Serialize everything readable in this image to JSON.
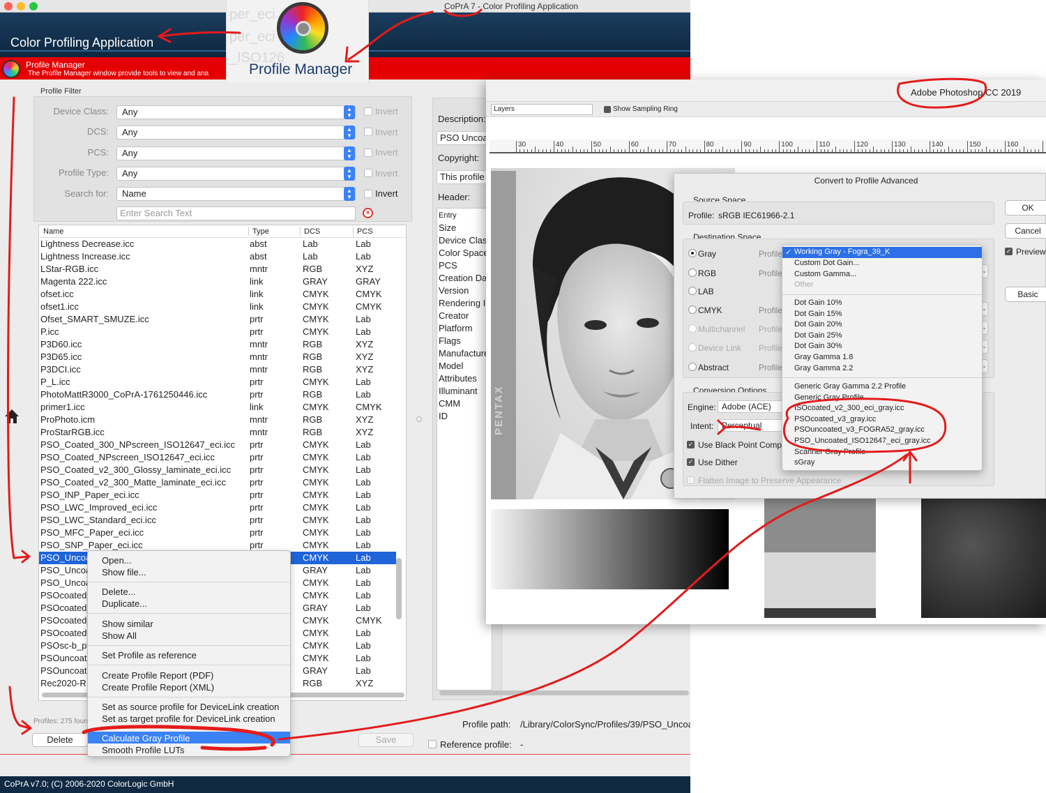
{
  "copra": {
    "window_title": "CoPrA 7 - Color Profiling Application",
    "app_title": "Color Profiling Application",
    "module_title": "Profile Manager",
    "module_desc": "The Profile Manager window provide tools to view and ana",
    "module_title_big": "Profile Manager",
    "ghost_texts": [
      "per_eci",
      "per_eci",
      "_ISO126",
      "_ISO12647_eci_gra",
      "d_NPscreen_ISO1261"
    ],
    "filter": {
      "section_label": "Profile Filter",
      "rows": [
        {
          "label": "Device Class:",
          "value": "Any",
          "invert": "Invert"
        },
        {
          "label": "DCS:",
          "value": "Any",
          "invert": "Invert"
        },
        {
          "label": "PCS:",
          "value": "Any",
          "invert": "Invert"
        },
        {
          "label": "Profile Type:",
          "value": "Any",
          "invert": "Invert"
        },
        {
          "label": "Search for:",
          "value": "Name",
          "invert": "Invert"
        }
      ],
      "search_placeholder": "Enter Search Text"
    },
    "table": {
      "headers": {
        "name": "Name",
        "type": "Type",
        "dcs": "DCS",
        "pcs": "PCS"
      },
      "rows": [
        [
          "Lightness Decrease.icc",
          "abst",
          "Lab",
          "Lab"
        ],
        [
          "Lightness Increase.icc",
          "abst",
          "Lab",
          "Lab"
        ],
        [
          "LStar-RGB.icc",
          "mntr",
          "RGB",
          "XYZ"
        ],
        [
          "Magenta 222.icc",
          "link",
          "GRAY",
          "GRAY"
        ],
        [
          "ofset.icc",
          "link",
          "CMYK",
          "CMYK"
        ],
        [
          "ofset1.icc",
          "link",
          "CMYK",
          "CMYK"
        ],
        [
          "Ofset_SMART_SMUZE.icc",
          "prtr",
          "CMYK",
          "Lab"
        ],
        [
          "P.icc",
          "prtr",
          "CMYK",
          "Lab"
        ],
        [
          "P3D60.icc",
          "mntr",
          "RGB",
          "XYZ"
        ],
        [
          "P3D65.icc",
          "mntr",
          "RGB",
          "XYZ"
        ],
        [
          "P3DCI.icc",
          "mntr",
          "RGB",
          "XYZ"
        ],
        [
          "P_L.icc",
          "prtr",
          "CMYK",
          "Lab"
        ],
        [
          "PhotoMattR3000_CoPrA-1761250446.icc",
          "prtr",
          "RGB",
          "Lab"
        ],
        [
          "primer1.icc",
          "link",
          "CMYK",
          "CMYK"
        ],
        [
          "ProPhoto.icm",
          "mntr",
          "RGB",
          "XYZ"
        ],
        [
          "ProStarRGB.icc",
          "mntr",
          "RGB",
          "XYZ"
        ],
        [
          "PSO_Coated_300_NPscreen_ISO12647_eci.icc",
          "prtr",
          "CMYK",
          "Lab"
        ],
        [
          "PSO_Coated_NPscreen_ISO12647_eci.icc",
          "prtr",
          "CMYK",
          "Lab"
        ],
        [
          "PSO_Coated_v2_300_Glossy_laminate_eci.icc",
          "prtr",
          "CMYK",
          "Lab"
        ],
        [
          "PSO_Coated_v2_300_Matte_laminate_eci.icc",
          "prtr",
          "CMYK",
          "Lab"
        ],
        [
          "PSO_INP_Paper_eci.icc",
          "prtr",
          "CMYK",
          "Lab"
        ],
        [
          "PSO_LWC_Improved_eci.icc",
          "prtr",
          "CMYK",
          "Lab"
        ],
        [
          "PSO_LWC_Standard_eci.icc",
          "prtr",
          "CMYK",
          "Lab"
        ],
        [
          "PSO_MFC_Paper_eci.icc",
          "prtr",
          "CMYK",
          "Lab"
        ],
        [
          "PSO_SNP_Paper_eci.icc",
          "prtr",
          "CMYK",
          "Lab"
        ],
        [
          "PSO_Uncoa",
          "",
          "CMYK",
          "Lab"
        ],
        [
          "PSO_Uncoa",
          "",
          "GRAY",
          "Lab"
        ],
        [
          "PSO_Uncoa",
          "",
          "CMYK",
          "Lab"
        ],
        [
          "PSOcoated_",
          "",
          "CMYK",
          "Lab"
        ],
        [
          "PSOcoated_",
          "",
          "GRAY",
          "Lab"
        ],
        [
          "PSOcoated_",
          "",
          "CMYK",
          "CMYK"
        ],
        [
          "PSOcoatedv",
          "",
          "CMYK",
          "Lab"
        ],
        [
          "PSOsc-b_pa",
          "",
          "CMYK",
          "Lab"
        ],
        [
          "PSOuncoate",
          "",
          "CMYK",
          "Lab"
        ],
        [
          "PSOuncoate",
          "",
          "GRAY",
          "Lab"
        ],
        [
          "Rec2020-R",
          "",
          "RGB",
          "XYZ"
        ]
      ],
      "selected_index": 25
    },
    "profiles_count": "Profiles: 275 foun",
    "delete_label": "Delete",
    "save_label": "Save",
    "info": {
      "description_label": "Description:",
      "description_value": "PSO Uncoat",
      "copyright_label": "Copyright:",
      "copyright_value": "This profile",
      "header_label": "Header:",
      "header_col": "Entry",
      "header_items": [
        "Size",
        "Device Class",
        "Color Space",
        "PCS",
        "Creation Dat",
        "Version",
        "Rendering In",
        "Creator",
        "Platform",
        "Flags",
        "Manufacture",
        "Model",
        "Attributes",
        "Illuminant",
        "CMM",
        "ID"
      ]
    },
    "profile_path_label": "Profile path:",
    "profile_path": "/Library/ColorSync/Profiles/39/PSO_Uncoa",
    "reference_label": "Reference profile:",
    "reference_value": "-",
    "status": "CoPrA v7.0; (C) 2006-2020 ColorLogic GmbH",
    "context_menu": {
      "items": [
        "Open...",
        "Show file...",
        "Delete...",
        "Duplicate...",
        "Show similar",
        "Show All",
        "Set Profile as reference",
        "Create Profile Report (PDF)",
        "Create Profile Report (XML)",
        "Set as source profile for DeviceLink creation",
        "Set as target profile for DeviceLink creation",
        "Calculate Gray Profile",
        "Smooth Profile LUTs"
      ],
      "highlighted": "Calculate Gray Profile"
    }
  },
  "photoshop": {
    "title": "Adobe Photoshop CC 2019",
    "layers_select": "Layers",
    "sampling_label": "Show Sampling Ring",
    "ruler_labels": [
      "30",
      "40",
      "50",
      "60",
      "70",
      "80",
      "90",
      "100",
      "110",
      "120",
      "130",
      "140",
      "150",
      "160"
    ],
    "photo_brand": "PENTAX",
    "dialog": {
      "title": "Convert to Profile Advanced",
      "source_space": "Source Space",
      "profile_label": "Profile:",
      "source_profile": "sRGB IEC61966-2.1",
      "dest_space": "Destination Space",
      "dest_options": [
        "Gray",
        "RGB",
        "LAB",
        "CMYK",
        "Multichannel",
        "Device Link",
        "Abstract"
      ],
      "profile_short": "Profile",
      "conversion_options": "Conversion Options",
      "engine_label": "Engine:",
      "engine_value": "Adobe (ACE)",
      "intent_label": "Intent:",
      "intent_value": "Perceptual",
      "black_point": "Use Black Point Compe",
      "dither": "Use Dither",
      "flatten": "Flatten Image to Preserve Appearance",
      "ok": "OK",
      "cancel": "Cancel",
      "preview": "Preview",
      "basic": "Basic"
    },
    "dropdown": {
      "selected": "Working Gray - Fogra_39_K",
      "group1": [
        "Custom Dot Gain...",
        "Custom Gamma...",
        "Other"
      ],
      "group2": [
        "Dot Gain 10%",
        "Dot Gain 15%",
        "Dot Gain 20%",
        "Dot Gain 25%",
        "Dot Gain 30%",
        "Gray Gamma 1.8",
        "Gray Gamma 2.2"
      ],
      "group3": [
        "Generic Gray Gamma 2.2 Profile",
        "Generic Gray Profile",
        "ISOcoated_v2_300_eci_gray.icc",
        "PSOcoated_v3_gray.icc",
        "PSOuncoated_v3_FOGRA52_gray.icc",
        "PSO_Uncoated_ISO12647_eci_gray.icc",
        "Scanner Gray Profile",
        "sGray"
      ]
    }
  },
  "colors": {
    "copra_banner": "#1b3d5e",
    "copra_red": "#e40000",
    "selection_blue": "#1f64d8",
    "annotation_red": "#e31b1b"
  }
}
